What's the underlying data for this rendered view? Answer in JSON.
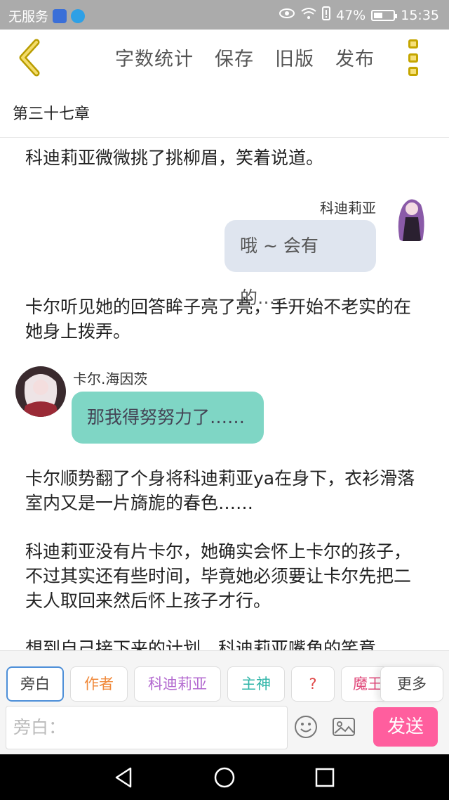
{
  "status_bar": {
    "carrier": "无服务",
    "battery": "47%",
    "battery_level": 0.47,
    "time": "15:35"
  },
  "toolbar": {
    "actions": [
      "字数统计",
      "保存",
      "旧版",
      "发布"
    ]
  },
  "chapter": {
    "title": "第三十七章"
  },
  "content": {
    "p1": "科迪莉亚微微挑了挑柳眉，笑着说道。",
    "msg1_name": "科迪莉亚",
    "msg1_text": "哦 ~ 会有的……",
    "p2": "卡尔听见她的回答眸子亮了亮，手开始不老实的在她身上拨弄。",
    "msg2_name": "卡尔.海因茨",
    "msg2_text": "那我得努努力了……",
    "p3": "卡尔顺势翻了个身将科迪莉亚ya在身下，衣衫滑落室内又是一片旖旎的春色……",
    "p4": "科迪莉亚没有片卡尔，她确实会怀上卡尔的孩子，不过其实还有些时间，毕竟她必须要让卡尔先把二夫人取回来然后怀上孩子才行。",
    "p5": "想到自己接下来的计划，科迪莉亚嘴角的笑意"
  },
  "roles": {
    "chips": [
      {
        "label": "旁白",
        "color": "#444444"
      },
      {
        "label": "作者",
        "color": "#f08a3c"
      },
      {
        "label": "科迪莉亚",
        "color": "#b36ad0"
      },
      {
        "label": "主神",
        "color": "#2fb5a8"
      },
      {
        "label": "?",
        "color": "#e04848"
      },
      {
        "label": "魔王",
        "color": "#e0487a"
      }
    ],
    "more": "更多",
    "input_placeholder": "旁白：",
    "send": "发送"
  }
}
